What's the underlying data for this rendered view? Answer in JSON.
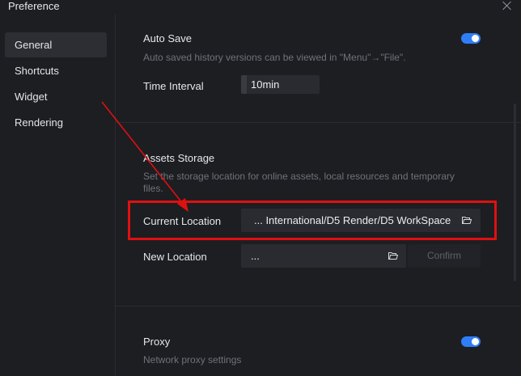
{
  "window": {
    "title": "Preference"
  },
  "sidebar": {
    "items": [
      {
        "label": "General",
        "active": true
      },
      {
        "label": "Shortcuts",
        "active": false
      },
      {
        "label": "Widget",
        "active": false
      },
      {
        "label": "Rendering",
        "active": false
      }
    ]
  },
  "auto_save": {
    "title": "Auto Save",
    "enabled": true,
    "description": "Auto saved history versions can be viewed in \"Menu\"→\"File\".",
    "interval_label": "Time Interval",
    "interval_value": "10min"
  },
  "assets_storage": {
    "title": "Assets Storage",
    "description_line1": "Set the storage location for online assets, local resources and temporary",
    "description_line2": "files.",
    "current_location_label": "Current Location",
    "current_location_value": "... International/D5 Render/D5 WorkSpace",
    "new_location_label": "New Location",
    "new_location_value": "...",
    "confirm_label": "Confirm"
  },
  "proxy": {
    "title": "Proxy",
    "enabled": true,
    "description": "Network proxy settings"
  },
  "colors": {
    "accent": "#2f7ef5",
    "annotation": "#e01010"
  },
  "icons": {
    "folder": "folder-open-icon",
    "close": "close-icon"
  }
}
